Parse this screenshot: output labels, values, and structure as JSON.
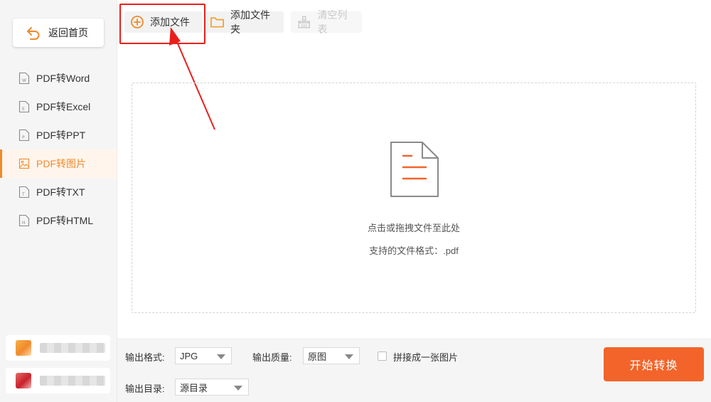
{
  "sidebar": {
    "back_label": "返回首页",
    "items": [
      {
        "label": "PDF转Word",
        "icon": "word-doc-icon",
        "letter": "W"
      },
      {
        "label": "PDF转Excel",
        "icon": "excel-doc-icon",
        "letter": "E"
      },
      {
        "label": "PDF转PPT",
        "icon": "ppt-doc-icon",
        "letter": "P"
      },
      {
        "label": "PDF转图片",
        "icon": "image-icon",
        "letter": ""
      },
      {
        "label": "PDF转TXT",
        "icon": "txt-doc-icon",
        "letter": "T"
      },
      {
        "label": "PDF转HTML",
        "icon": "html-doc-icon",
        "letter": "H"
      }
    ],
    "active_index": 3
  },
  "toolbar": {
    "add_file": "添加文件",
    "add_folder": "添加文件夹",
    "clear_list": "清空列表"
  },
  "dropzone": {
    "hint": "点击或拖拽文件至此处",
    "formats": "支持的文件格式：.pdf"
  },
  "settings": {
    "format_label": "输出格式:",
    "format_value": "JPG",
    "quality_label": "输出质量:",
    "quality_value": "原图",
    "merge_label": "拼接成一张图片",
    "merge_checked": false,
    "dir_label": "输出目录:",
    "dir_value": "源目录"
  },
  "start_button": "开始转换",
  "colors": {
    "accent": "#f08a2c",
    "start": "#f2642a",
    "annotation": "#e8201c"
  }
}
